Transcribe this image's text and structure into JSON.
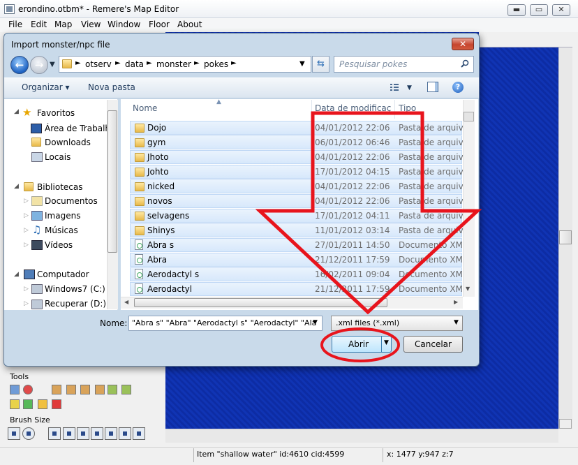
{
  "window": {
    "title": "erondino.otbm* - Remere's Map Editor",
    "controls": {
      "minimize": "▬",
      "maximize": "▭",
      "close": "✕"
    }
  },
  "menu": [
    "File",
    "Edit",
    "Map",
    "View",
    "Window",
    "Floor",
    "About"
  ],
  "palette": {
    "tools_label": "Tools",
    "brush_size_label": "Brush Size"
  },
  "status": {
    "item": "Item \"shallow water\" id:4610 cid:4599",
    "coords": "x: 1477 y:947 z:7"
  },
  "dialog": {
    "title": "Import monster/npc file",
    "close": "✕",
    "breadcrumbs": [
      "otserv",
      "data",
      "monster",
      "pokes"
    ],
    "search_placeholder": "Pesquisar pokes",
    "toolbar": {
      "organize": "Organizar ▾",
      "new_folder": "Nova pasta",
      "help": "?"
    },
    "nav": {
      "favorites": "Favoritos",
      "desktop": "Área de Trabalho",
      "downloads": "Downloads",
      "places": "Locais",
      "libraries": "Bibliotecas",
      "documents": "Documentos",
      "images": "Imagens",
      "music": "Músicas",
      "videos": "Vídeos",
      "computer": "Computador",
      "drive_c": "Windows7 (C:)",
      "drive_d": "Recuperar (D:)"
    },
    "columns": {
      "name": "Nome",
      "date": "Data de modificaç...",
      "type": "Tipo"
    },
    "files": [
      {
        "name": "Dojo",
        "date": "04/01/2012 22:06",
        "type": "Pasta de arquivos",
        "icon": "folder"
      },
      {
        "name": "gym",
        "date": "06/01/2012 06:46",
        "type": "Pasta de arquivos",
        "icon": "folder"
      },
      {
        "name": "Jhoto",
        "date": "04/01/2012 22:06",
        "type": "Pasta de arquivos",
        "icon": "folder"
      },
      {
        "name": "Johto",
        "date": "17/01/2012 04:15",
        "type": "Pasta de arquivos",
        "icon": "folder"
      },
      {
        "name": "nicked",
        "date": "04/01/2012 22:06",
        "type": "Pasta de arquivos",
        "icon": "folder"
      },
      {
        "name": "novos",
        "date": "04/01/2012 22:06",
        "type": "Pasta de arquivos",
        "icon": "folder"
      },
      {
        "name": "selvagens",
        "date": "17/01/2012 04:11",
        "type": "Pasta de arquivos",
        "icon": "folder"
      },
      {
        "name": "Shinys",
        "date": "11/01/2012 03:14",
        "type": "Pasta de arquivos",
        "icon": "folder"
      },
      {
        "name": "Abra s",
        "date": "27/01/2011 14:50",
        "type": "Documento XML",
        "icon": "xml"
      },
      {
        "name": "Abra",
        "date": "21/12/2011 17:59",
        "type": "Documento XML",
        "icon": "xml"
      },
      {
        "name": "Aerodactyl s",
        "date": "16/02/2011 09:04",
        "type": "Documento XML",
        "icon": "xml"
      },
      {
        "name": "Aerodactyl",
        "date": "21/12/2011 17:59",
        "type": "Documento XML",
        "icon": "xml"
      }
    ],
    "filename_label": "Nome:",
    "filename_value": "\"Abra s\" \"Abra\" \"Aerodactyl s\" \"Aerodactyl\" \"Ala",
    "filter": ".xml files (*.xml)",
    "open": "Abrir",
    "cancel": "Cancelar"
  },
  "colors": {
    "annotation": "#e8141c",
    "map_water": "#1232b0",
    "dialog_frame": "#c9daea"
  }
}
